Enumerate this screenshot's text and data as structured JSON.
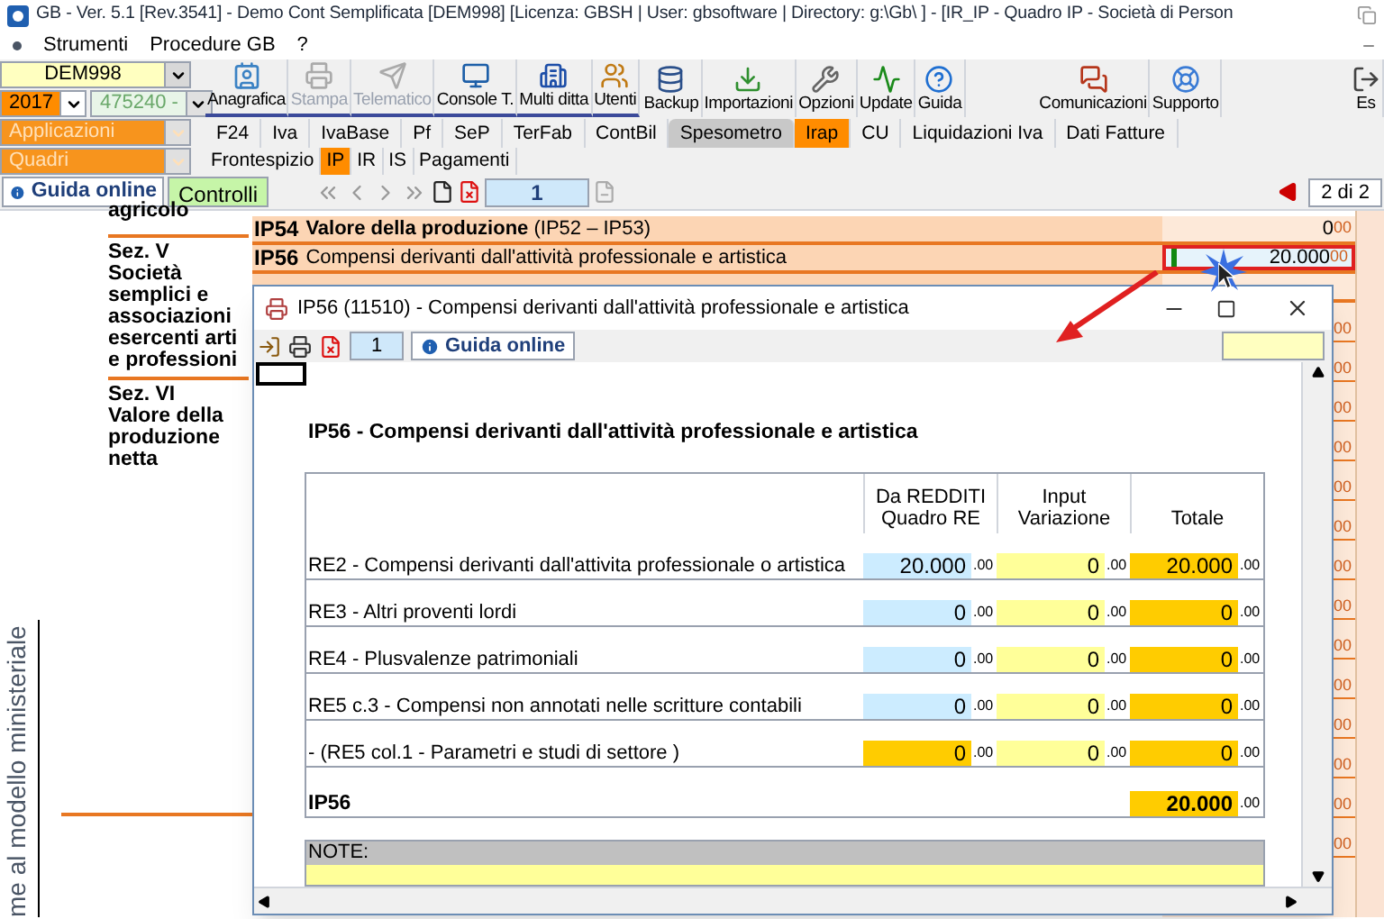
{
  "window": {
    "title": "GB - Ver. 5.1 [Rev.3541] -  Demo Cont Semplificata [DEM998]   [Licenza: GBSH | User: gbsoftware | Directory: g:\\Gb\\ ] - [IR_IP - Quadro IP - Società di Person"
  },
  "menu": [
    "Strumenti",
    "Procedure GB",
    "?"
  ],
  "selectors": {
    "company": "DEM998",
    "year": "2017",
    "code": "475240 -",
    "applications": "Applicazioni",
    "sections": "Quadri"
  },
  "toolbar": [
    {
      "label": "Anagrafica",
      "disabled": false
    },
    {
      "label": "Stampa",
      "disabled": true
    },
    {
      "label": "Telematico",
      "disabled": true
    },
    {
      "label": "Console T.",
      "disabled": false
    },
    {
      "label": "Multi ditta",
      "disabled": false
    },
    {
      "label": "Utenti",
      "disabled": false
    },
    {
      "label": "Backup",
      "disabled": false
    },
    {
      "label": "Importazioni",
      "disabled": false
    },
    {
      "label": "Opzioni",
      "disabled": false
    },
    {
      "label": "Update",
      "disabled": false
    },
    {
      "label": "Guida",
      "disabled": false
    },
    {
      "label": "Comunicazioni",
      "disabled": false
    },
    {
      "label": "Supporto",
      "disabled": false
    },
    {
      "label": "Es",
      "disabled": false
    }
  ],
  "module_tabs": [
    {
      "label": "F24",
      "selected": false,
      "highlighted": false
    },
    {
      "label": "Iva",
      "selected": false,
      "highlighted": false
    },
    {
      "label": "IvaBase",
      "selected": false,
      "highlighted": false
    },
    {
      "label": "Pf",
      "selected": false,
      "highlighted": false
    },
    {
      "label": "SeP",
      "selected": false,
      "highlighted": false
    },
    {
      "label": "TerFab",
      "selected": false,
      "highlighted": false
    },
    {
      "label": "ContBil",
      "selected": false,
      "highlighted": false
    },
    {
      "label": "Spesometro",
      "selected": false,
      "highlighted": true
    },
    {
      "label": "Irap",
      "selected": true,
      "highlighted": false
    },
    {
      "label": "CU",
      "selected": false,
      "highlighted": false
    },
    {
      "label": "Liquidazioni Iva",
      "selected": false,
      "highlighted": false
    },
    {
      "label": "Dati Fatture",
      "selected": false,
      "highlighted": false
    }
  ],
  "quadro_tabs": [
    {
      "label": "Frontespizio",
      "selected": false
    },
    {
      "label": "IP",
      "selected": true
    },
    {
      "label": "IR",
      "selected": false
    },
    {
      "label": "IS",
      "selected": false
    },
    {
      "label": "Pagamenti",
      "selected": false
    }
  ],
  "navigation": {
    "help": "Guida online",
    "checks": "Controlli",
    "page": "1",
    "page_count": "2 di 2"
  },
  "form": {
    "sections": [
      {
        "title": "agricolo"
      },
      {
        "title": "Sez. V",
        "text": "Società semplici e associazioni esercenti arti e professioni"
      },
      {
        "title": "Sez. VI",
        "text": "Valore della produzione netta"
      }
    ],
    "rows": [
      {
        "code": "IP54",
        "label": "**Valore della produzione** (IP52 – IP53)",
        "value": "0",
        "decimals": "00",
        "selected": false
      },
      {
        "code": "IP56",
        "label": "Compensi derivanti dall'attività professionale e artistica",
        "value": "20.000",
        "decimals": "00",
        "selected": true
      }
    ],
    "column_fragments": [
      "00",
      "00",
      "00",
      "00",
      "00",
      "00",
      "00",
      "00",
      "00",
      "00",
      "00",
      "00",
      "00",
      "00"
    ],
    "side_caption": "me al modello ministeriale"
  },
  "dialog": {
    "title": "IP56 (11510) - Compensi derivanti dall'attività professionale e artistica",
    "page": "1",
    "help": "Guida online",
    "heading": "IP56 - Compensi derivanti dall'attività professionale e artistica",
    "columns": [
      "Da REDDITI\nQuadro RE",
      "Input\nVariazione",
      "Totale"
    ],
    "rows": [
      {
        "label": "RE2  - Compensi derivanti dall'attivita professionale o artistica",
        "cells": [
          {
            "kind": "source",
            "value": "20.000",
            "decimals": ".00"
          },
          {
            "kind": "input",
            "value": "0",
            "decimals": ".00"
          },
          {
            "kind": "computed",
            "value": "20.000",
            "decimals": ".00"
          }
        ]
      },
      {
        "label": "RE3 - Altri proventi lordi",
        "cells": [
          {
            "kind": "source",
            "value": "0",
            "decimals": ".00"
          },
          {
            "kind": "input",
            "value": "0",
            "decimals": ".00"
          },
          {
            "kind": "computed",
            "value": "0",
            "decimals": ".00"
          }
        ]
      },
      {
        "label": "RE4 - Plusvalenze patrimoniali",
        "cells": [
          {
            "kind": "source",
            "value": "0",
            "decimals": ".00"
          },
          {
            "kind": "input",
            "value": "0",
            "decimals": ".00"
          },
          {
            "kind": "computed",
            "value": "0",
            "decimals": ".00"
          }
        ]
      },
      {
        "label": "RE5 c.3 - Compensi non annotati nelle scritture contabili",
        "cells": [
          {
            "kind": "source",
            "value": "0",
            "decimals": ".00"
          },
          {
            "kind": "input",
            "value": "0",
            "decimals": ".00"
          },
          {
            "kind": "computed",
            "value": "0",
            "decimals": ".00"
          }
        ]
      },
      {
        "label": "-  (RE5 col.1 - Parametri e studi di settore )",
        "cells": [
          {
            "kind": "computed",
            "value": "0",
            "decimals": ".00"
          },
          {
            "kind": "input",
            "value": "0",
            "decimals": ".00"
          },
          {
            "kind": "computed",
            "value": "0",
            "decimals": ".00"
          }
        ]
      }
    ],
    "total": {
      "label": "IP56",
      "value": "20.000",
      "decimals": ".00"
    },
    "notes_label": "NOTE:"
  }
}
